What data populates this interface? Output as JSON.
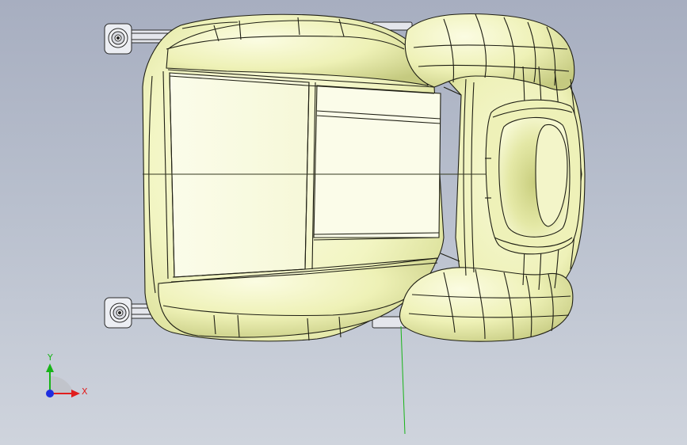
{
  "viewport": {
    "background_top": "#a7aec0",
    "background_bottom": "#cfd4dd",
    "model_fill": "#f1f4bf",
    "model_fill_light": "#fafbe3",
    "model_shadow": "#cdd289",
    "edge_color": "#1f1f14",
    "hardware_fill": "#e6e8ee"
  },
  "triad": {
    "x_label": "X",
    "y_label": "Y",
    "x_color": "#e01e1e",
    "y_color": "#18b418",
    "z_color": "#1e2ee0"
  }
}
